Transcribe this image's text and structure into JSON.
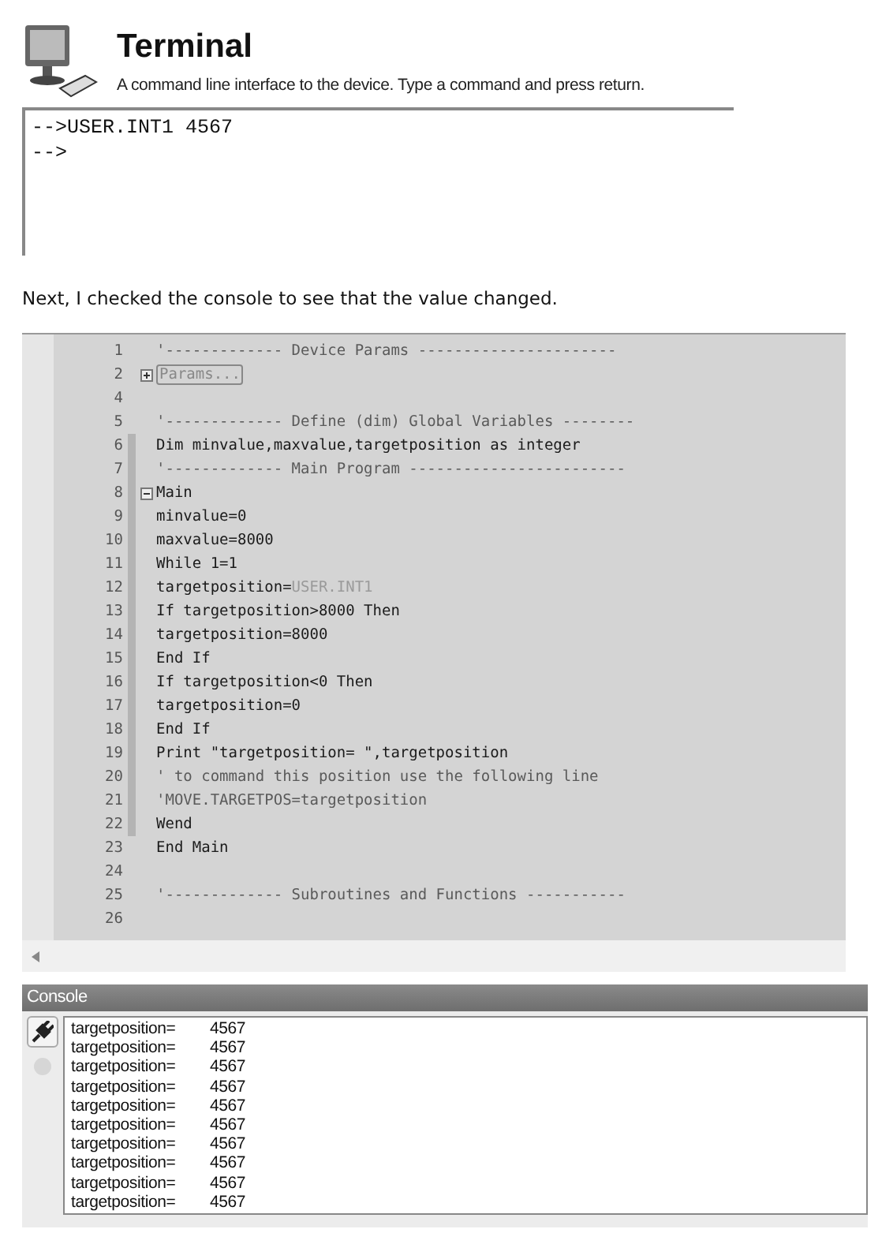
{
  "terminal": {
    "title": "Terminal",
    "subtitle": "A command line interface to the device. Type a command and press return.",
    "lines": [
      "-->USER.INT1 4567",
      "-->"
    ]
  },
  "paragraph": "Next, I checked the console to see that the value changed.",
  "editor": {
    "lines": [
      {
        "number": "1",
        "kind": "comment",
        "text": "'------------- Device Params ----------------------",
        "changed": false
      },
      {
        "number": "2",
        "kind": "collapsed",
        "text": "Params...",
        "changed": false
      },
      {
        "number": "4",
        "kind": "code",
        "changed": false
      },
      {
        "number": "5",
        "kind": "comment",
        "text": "'------------- Define (dim) Global Variables --------",
        "changed": false
      },
      {
        "number": "6",
        "kind": "code",
        "text": "Dim minvalue,maxvalue,targetposition as integer",
        "changed": true
      },
      {
        "number": "7",
        "kind": "comment",
        "text": "'------------- Main Program ------------------------",
        "changed": true
      },
      {
        "number": "8",
        "kind": "fold",
        "text": "Main",
        "changed": true
      },
      {
        "number": "9",
        "kind": "code",
        "text": "minvalue=0",
        "changed": true
      },
      {
        "number": "10",
        "kind": "code",
        "text": "maxvalue=8000",
        "changed": true
      },
      {
        "number": "11",
        "kind": "code",
        "text": "While 1=1",
        "changed": true
      },
      {
        "number": "12",
        "kind": "code",
        "text": "targetposition=",
        "dim": "USER.INT1",
        "changed": true
      },
      {
        "number": "13",
        "kind": "code",
        "text": "If targetposition>8000 Then",
        "changed": true
      },
      {
        "number": "14",
        "kind": "code",
        "text": "targetposition=8000",
        "changed": true
      },
      {
        "number": "15",
        "kind": "code",
        "text": "End If",
        "changed": true
      },
      {
        "number": "16",
        "kind": "code",
        "text": "If targetposition<0 Then",
        "changed": true
      },
      {
        "number": "17",
        "kind": "code",
        "text": "targetposition=0",
        "changed": true
      },
      {
        "number": "18",
        "kind": "code",
        "text": "End If",
        "changed": true
      },
      {
        "number": "19",
        "kind": "code",
        "text": "Print \"targetposition= \",targetposition",
        "changed": true
      },
      {
        "number": "20",
        "kind": "comment",
        "text": "' to command this position use the following line",
        "changed": true
      },
      {
        "number": "21",
        "kind": "comment",
        "text": "'MOVE.TARGETPOS=targetposition",
        "changed": true
      },
      {
        "number": "22",
        "kind": "code",
        "text": "Wend",
        "changed": true
      },
      {
        "number": "23",
        "kind": "code",
        "text": "End Main",
        "changed": false
      },
      {
        "number": "24",
        "kind": "code",
        "changed": false
      },
      {
        "number": "25",
        "kind": "comment",
        "text": "'------------- Subroutines and Functions -----------",
        "changed": false
      },
      {
        "number": "26",
        "kind": "code",
        "changed": false
      }
    ]
  },
  "console": {
    "title": "Console",
    "rows": [
      {
        "label": "targetposition=",
        "value": "4567"
      },
      {
        "label": "targetposition=",
        "value": "4567"
      },
      {
        "label": "targetposition=",
        "value": "4567"
      },
      {
        "label": "targetposition=",
        "value": "4567"
      },
      {
        "label": "targetposition=",
        "value": "4567"
      },
      {
        "label": "targetposition=",
        "value": "4567"
      },
      {
        "label": "targetposition=",
        "value": "4567"
      },
      {
        "label": "targetposition=",
        "value": "4567"
      },
      {
        "label": "targetposition=",
        "value": "4567"
      },
      {
        "label": "targetposition=",
        "value": "4567"
      }
    ]
  }
}
